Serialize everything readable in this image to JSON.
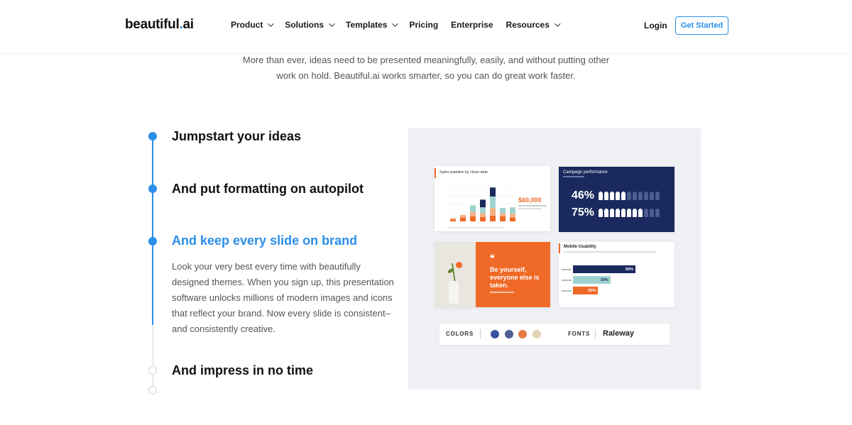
{
  "header": {
    "logo_main": "beautiful",
    "logo_dot": ".",
    "logo_suffix": "ai",
    "nav": [
      {
        "label": "Product",
        "has_menu": true
      },
      {
        "label": "Solutions",
        "has_menu": true
      },
      {
        "label": "Templates",
        "has_menu": true
      },
      {
        "label": "Pricing",
        "has_menu": false
      },
      {
        "label": "Enterprise",
        "has_menu": false
      },
      {
        "label": "Resources",
        "has_menu": true
      }
    ],
    "login_label": "Login",
    "cta_label": "Get Started"
  },
  "intro": {
    "text": "More than ever, ideas need to be presented meaningfully, easily, and without putting other work on hold. Beautiful.ai works smarter, so you can do great work faster."
  },
  "steps": [
    {
      "title": "Jumpstart your ideas",
      "state": "done"
    },
    {
      "title": "And put formatting on autopilot",
      "state": "done"
    },
    {
      "title": "And keep every slide on brand",
      "state": "current",
      "description": "Look your very best every time with beautifully designed themes. When you sign up, this presentation software unlocks millions of modern images and icons that reflect your brand. Now every slide is consistent–and consistently creative."
    },
    {
      "title": "And impress in no time",
      "state": "upcoming"
    }
  ],
  "preview": {
    "sales": {
      "title": "Sales pipeline by close date",
      "big_value": "$60,000",
      "stacks": [
        [
          3,
          2,
          0,
          0
        ],
        [
          6,
          4,
          0,
          0
        ],
        [
          8,
          7,
          10,
          0
        ],
        [
          7,
          6,
          9,
          12
        ],
        [
          9,
          12,
          18,
          14
        ],
        [
          8,
          5,
          8,
          0
        ],
        [
          6,
          6,
          10,
          0
        ]
      ],
      "colors": [
        "#f06a27",
        "#f3b084",
        "#9fd3cf",
        "#1b2a5e"
      ]
    },
    "campaign": {
      "title": "Campaign performance",
      "rows": [
        {
          "value": "46%",
          "filled": 5,
          "total": 11
        },
        {
          "value": "75%",
          "filled": 8,
          "total": 11
        }
      ]
    },
    "quote": {
      "mark": "❝",
      "text": "Be yourself, everyone else is taken."
    },
    "usability": {
      "title": "Mobile Usability",
      "bars": [
        {
          "value": 50,
          "label": "50%",
          "color": "#1b2a5e",
          "text_color": "#ffffff"
        },
        {
          "value": 30,
          "label": "30%",
          "color": "#9fd3cf",
          "text_color": "#1b2a5e"
        },
        {
          "value": 20,
          "label": "20%",
          "color": "#f06a27",
          "text_color": "#ffffff"
        }
      ]
    },
    "brand": {
      "colors_label": "COLORS",
      "fonts_label": "FONTS",
      "font_name": "Raleway",
      "swatches": [
        "#3d52a0",
        "#4f5f95",
        "#e87a45",
        "#e2d3b8"
      ]
    }
  }
}
